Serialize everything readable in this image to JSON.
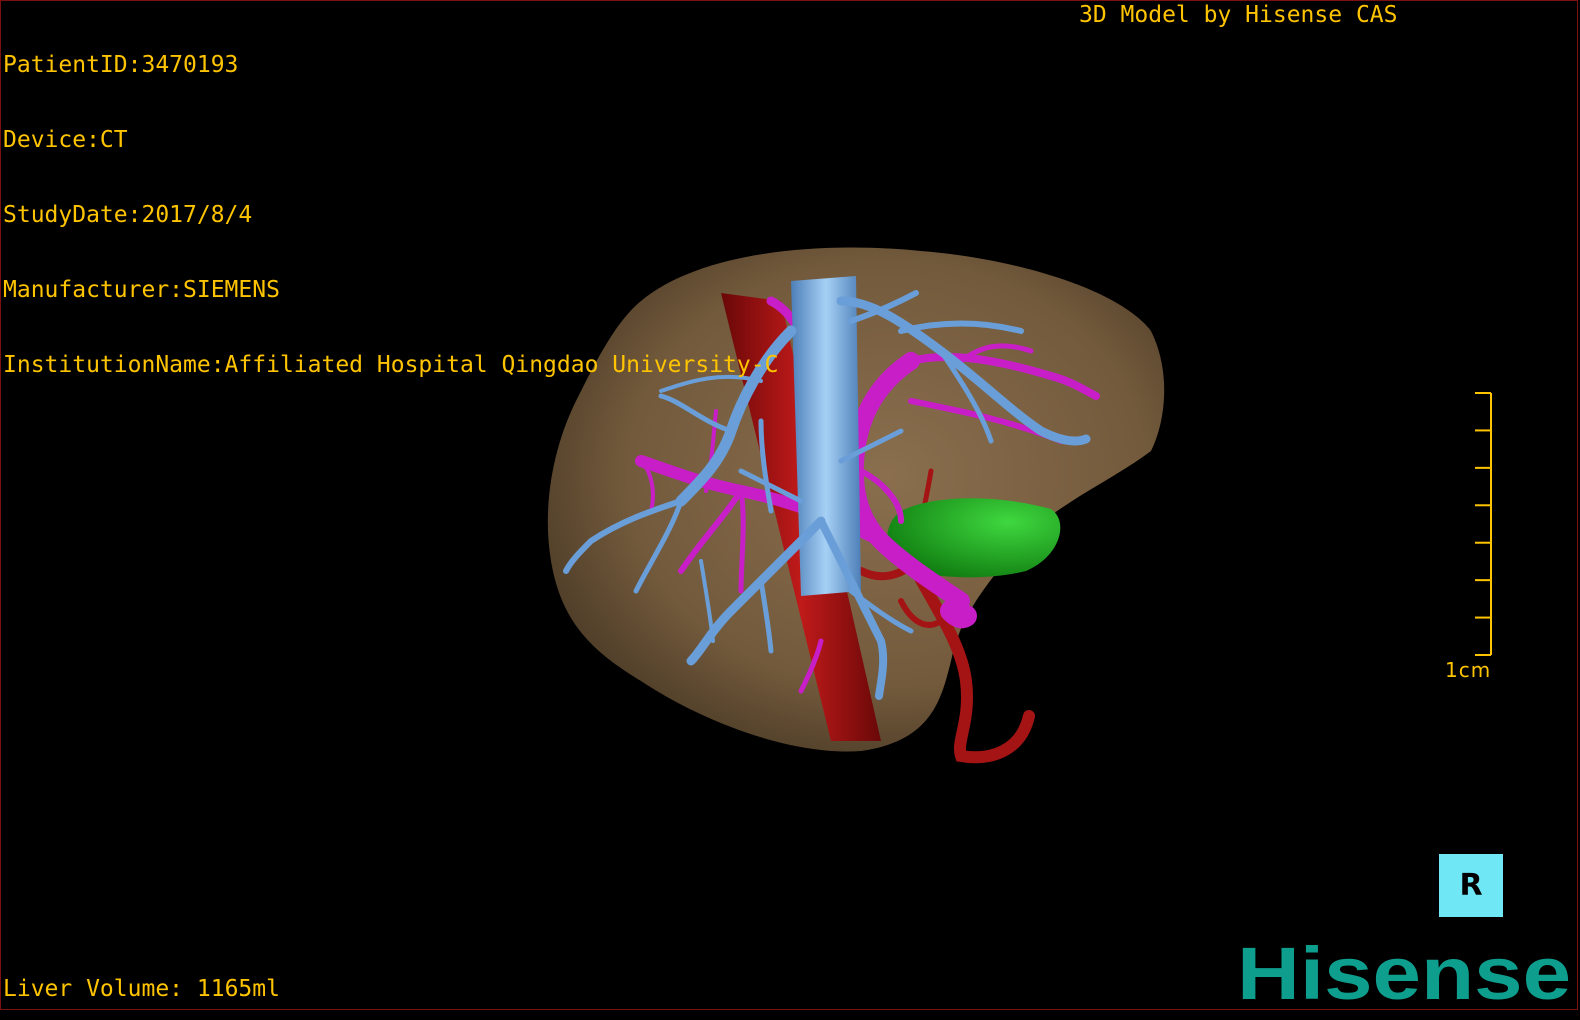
{
  "patient_info": {
    "patient_id": "PatientID:3470193",
    "device": "Device:CT",
    "study_date": "StudyDate:2017/8/4",
    "manufacturer": "Manufacturer:SIEMENS",
    "institution": "InstitutionName:Affiliated Hospital Qingdao University-C"
  },
  "header": {
    "model_credit": "3D Model by Hisense CAS"
  },
  "footer": {
    "label": "Liver Volume:",
    "value": "1165ml"
  },
  "scale_bar": {
    "label": "1cm",
    "tick_count": 8
  },
  "orientation_widget": {
    "glyph": "R",
    "icon": "orientation-cube-icon"
  },
  "logo": {
    "text": "Hisense"
  },
  "colors": {
    "overlay_text": "#ffc400",
    "liver": "#7d6446",
    "hepatic_vein": "#6a9ed8",
    "portal_vein": "#c81ec8",
    "artery": "#a01212",
    "gallbladder": "#1aa01a",
    "logo": "#0e9e8e",
    "orientation_bg": "#6fe7f4"
  }
}
